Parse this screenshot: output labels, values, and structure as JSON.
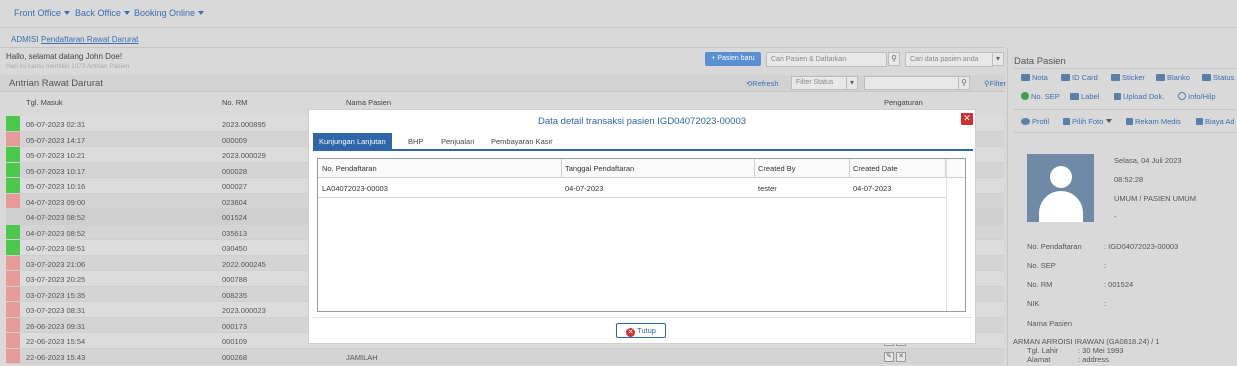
{
  "nav": {
    "items": [
      "Front Office",
      "Back Office",
      "Booking Online"
    ]
  },
  "breadcrumb": {
    "tab1": "ADMISI",
    "tab2": "Pendaftaran Rawat Darurat"
  },
  "greeting": {
    "hello": "Hallo, selamat datang John Doe!",
    "queue": "Hari ini kamu memiliki 1073 Antrian Pasien"
  },
  "toolbar": {
    "new_patient": "+ Pasien baru",
    "search_register_placeholder": "Cari Pasien & Daftarkan",
    "search_patient_placeholder": "Cari data pasien anda",
    "refresh": "Refresh",
    "filter_status_placeholder": "Filter Status",
    "filter": "Filter"
  },
  "panel": {
    "title": "Antrian Rawat Darurat"
  },
  "table": {
    "headers": [
      "Tgl. Masuk",
      "No. RM",
      "Nama Pasien",
      "Pengaturan"
    ],
    "rows": [
      {
        "date": "06-07-2023 02:31",
        "rm": "2023.000895",
        "name": "",
        "status": "green"
      },
      {
        "date": "05-07-2023 14:17",
        "rm": "000009",
        "name": "",
        "status": "red"
      },
      {
        "date": "05-07-2023 10:21",
        "rm": "2023.000029",
        "name": "",
        "status": "green"
      },
      {
        "date": "05-07-2023 10:17",
        "rm": "000028",
        "name": "",
        "status": "green"
      },
      {
        "date": "05-07-2023 10:16",
        "rm": "000027",
        "name": "",
        "status": "green"
      },
      {
        "date": "04-07-2023 09:00",
        "rm": "023604",
        "name": "",
        "status": "red"
      },
      {
        "date": "04-07-2023 08:52",
        "rm": "001524",
        "name": "",
        "status": "none"
      },
      {
        "date": "04-07-2023 08:52",
        "rm": "035613",
        "name": "",
        "status": "green"
      },
      {
        "date": "04-07-2023 08:51",
        "rm": "030450",
        "name": "",
        "status": "green"
      },
      {
        "date": "03-07-2023 21:06",
        "rm": "2022.000245",
        "name": "",
        "status": "red"
      },
      {
        "date": "03-07-2023 20:25",
        "rm": "000788",
        "name": "",
        "status": "red"
      },
      {
        "date": "03-07-2023 15:35",
        "rm": "008235",
        "name": "",
        "status": "red"
      },
      {
        "date": "03-07-2023 08:31",
        "rm": "2023.000023",
        "name": "",
        "status": "red"
      },
      {
        "date": "26-06-2023 09:31",
        "rm": "000173",
        "name": "",
        "status": "red"
      },
      {
        "date": "22-06-2023 15:54",
        "rm": "000109",
        "name": "",
        "status": "red"
      },
      {
        "date": "22-06-2023 15:43",
        "rm": "000268",
        "name": "JAMILAH",
        "status": "red"
      }
    ]
  },
  "side": {
    "title": "Data Pasien",
    "tb1": [
      "Nota",
      "ID Card",
      "Sticker",
      "Blanko",
      "Status"
    ],
    "tb2": [
      "No. SEP",
      "Label",
      "Upload Dok.",
      "Info/Hilp"
    ],
    "tb3": [
      "Profil",
      "Pilih Foto",
      "Rekam Medis",
      "Biaya Ad"
    ],
    "date": "Selasa, 04 Juli 2023",
    "time": "08:52:28",
    "type": "UMUM / PASIEN UMUM",
    "dash": "-",
    "no_pendaftaran_label": "No. Pendaftaran",
    "no_pendaftaran_value": ": IGD04072023-00003",
    "no_sep_label": "No. SEP",
    "no_sep_value": ":",
    "no_rm_label": "No. RM",
    "no_rm_value": ": 001524",
    "nik_label": "NIK",
    "nik_value": ":",
    "nama_label": "Nama Pasien",
    "nama_value": "ARMAN ARROISI IRAWAN (GA0818.24) / 1",
    "tgl_lahir_label": "Tgl. Lahir",
    "tgl_lahir_value": ": 30 Mei 1993",
    "alamat_label": "Alamat",
    "alamat_value": ": address"
  },
  "modal": {
    "title": "Data detail transaksi pasien IGD04072023-00003",
    "tabs": [
      "Kunjungan Lanjutan",
      "BHP",
      "Penjualan",
      "Pembayaran Kasir"
    ],
    "columns": [
      "No. Pendaftaran",
      "Tanggal Pendaftaran",
      "Created By",
      "Created Date"
    ],
    "rows": [
      [
        "LA04072023-00003",
        "04-07-2023",
        "tester",
        "04-07-2023"
      ]
    ],
    "close_button": "Tutup"
  },
  "colors": {
    "accent": "#2f66a8",
    "green": "#4cc94c",
    "red": "#e79a9a",
    "danger": "#d32f2f"
  }
}
